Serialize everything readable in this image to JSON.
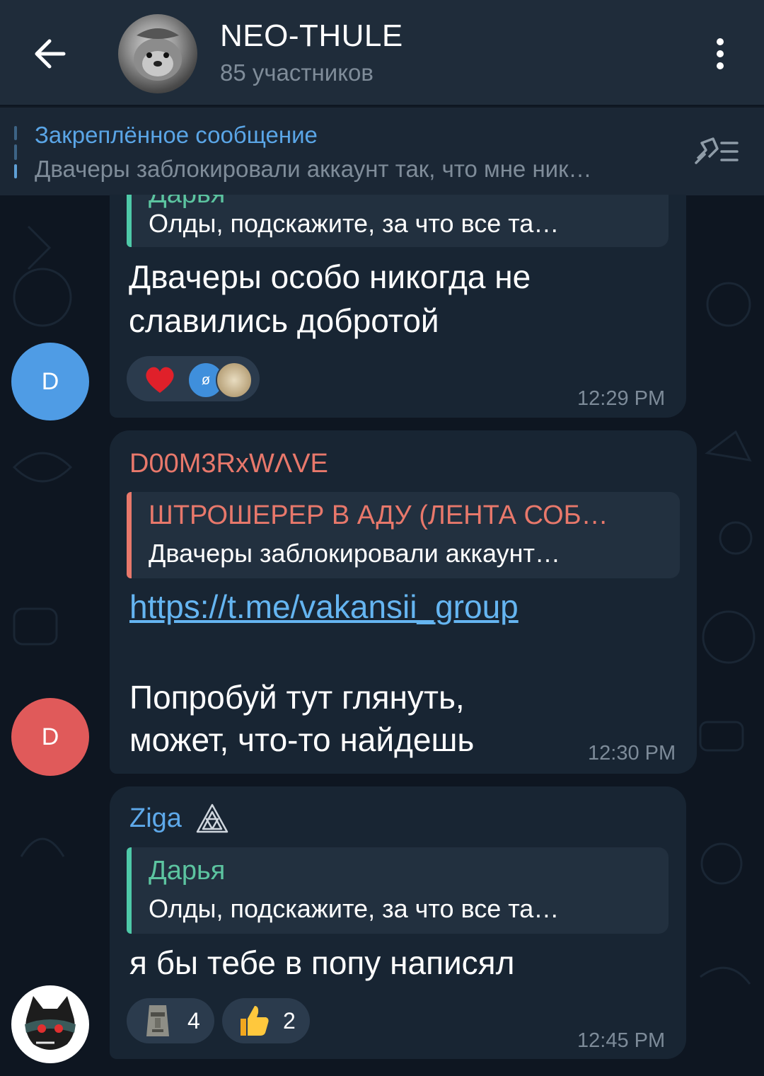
{
  "header": {
    "title": "NEO-THULE",
    "subtitle": "85 участников"
  },
  "pinned": {
    "title": "Закреплённое сообщение",
    "text": "Двачеры заблокировали аккаунт так, что мне ник…"
  },
  "messages": [
    {
      "reply_name": "Дарья",
      "reply_text": "Олды, подскажите, за что все та…",
      "text_line1": "Двачеры особо никогда не",
      "text_line2": "славились добротой",
      "time": "12:29 PM",
      "avatar_letter": "D",
      "avatar_color": "#4f9ce5",
      "reactions": [
        {
          "icon": "heart-icon",
          "badge": "ø"
        }
      ]
    },
    {
      "sender": "D00M3RxWΛVE",
      "sender_color": "#e8786b",
      "reply_name": "ШТРОШЕРЕР В АДУ (ЛЕНТА СОБ…",
      "reply_text": "Двачеры заблокировали аккаунт…",
      "link": "https://t.me/vakansii_group",
      "text_line1": "Попробуй тут глянуть,",
      "text_line2": "может, что-то найдешь",
      "time": "12:30 PM",
      "avatar_letter": "D",
      "avatar_color": "#e05a5a"
    },
    {
      "sender": "Ziga",
      "sender_color": "#5ea9ea",
      "reply_name": "Дарья",
      "reply_text": "Олды, подскажите, за что все та…",
      "text_line1": "я бы тебе в попу написял",
      "time": "12:45 PM",
      "reactions": [
        {
          "icon": "moai-icon",
          "count": "4"
        },
        {
          "icon": "thumbs-up-icon",
          "count": "2"
        }
      ]
    }
  ],
  "colors": {
    "background": "#0e1621",
    "header": "#1f2c3a",
    "bubble": "#182533",
    "accent": "#5aa5e6",
    "reply_bar_green": "#4ec9a8",
    "reply_name_green": "#5cc4a0",
    "reply_red": "#e8786b"
  }
}
